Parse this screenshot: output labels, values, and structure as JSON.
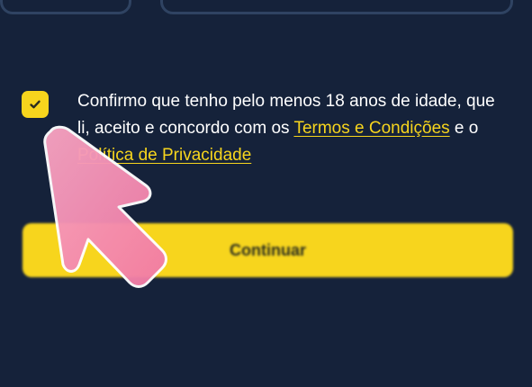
{
  "consent": {
    "checked": true,
    "text_prefix": "Confirmo que tenho pelo menos 18 anos de idade, que li, aceito e concordo com os ",
    "terms_link": "Termos e Condições",
    "text_middle": " e o ",
    "privacy_link": "Política de Privacidade"
  },
  "continue_button": {
    "label": "Continuar"
  },
  "colors": {
    "background": "#15223a",
    "accent": "#f7d51d",
    "pointer": "#f58fb2"
  },
  "icons": {
    "checkbox": "check-icon",
    "pointer": "pointer-arrow-icon"
  }
}
